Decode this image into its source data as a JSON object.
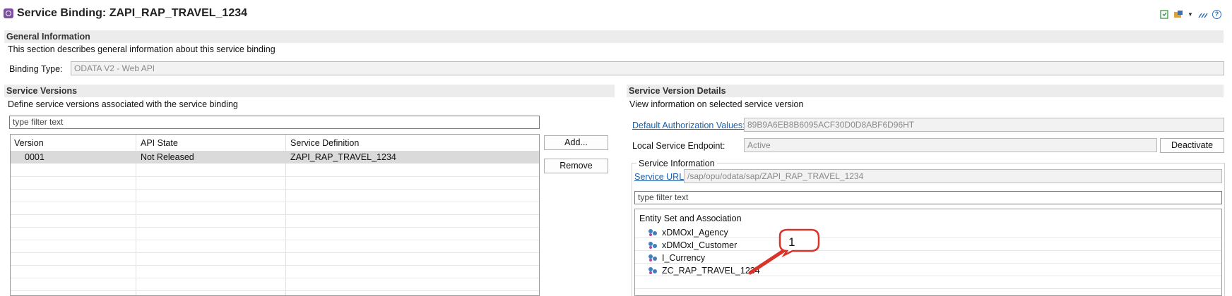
{
  "window": {
    "title": "Service Binding: ZAPI_RAP_TRAVEL_1234"
  },
  "general": {
    "heading": "General Information",
    "description": "This section describes general information about this service binding",
    "binding_type_label": "Binding Type:",
    "binding_type_value": "ODATA V2 - Web API"
  },
  "versions": {
    "heading": "Service Versions",
    "description": "Define service versions associated with the service binding",
    "filter_placeholder": "type filter text",
    "columns": [
      "Version",
      "API State",
      "Service Definition"
    ],
    "rows": [
      {
        "version": "0001",
        "api_state": "Not Released",
        "service_definition": "ZAPI_RAP_TRAVEL_1234"
      }
    ],
    "add_label": "Add...",
    "remove_label": "Remove"
  },
  "details": {
    "heading": "Service Version Details",
    "description": "View information on selected service version",
    "auth_link": "Default Authorization Values:",
    "auth_value": "89B9A6EB8B6095ACF30D0D8ABF6D96HT",
    "endpoint_label": "Local Service Endpoint:",
    "endpoint_value": "Active",
    "deactivate_label": "Deactivate",
    "service_info_legend": "Service Information",
    "service_url_link": "Service URL:",
    "service_url_value": "/sap/opu/odata/sap/ZAPI_RAP_TRAVEL_1234",
    "filter_placeholder": "type filter text",
    "entity_header": "Entity Set and Association",
    "entities": [
      "xDMOxI_Agency",
      "xDMOxI_Customer",
      "I_Currency",
      "ZC_RAP_TRAVEL_1234"
    ]
  },
  "callout": {
    "number": "1"
  },
  "colors": {
    "section_bg": "#ececec",
    "link": "#1c5fa8",
    "selected_row": "#dadada",
    "callout_red": "#d9342b"
  },
  "toolbar_icons": [
    "export-icon",
    "settings-icon",
    "dropdown-icon",
    "edit-icon",
    "help-icon"
  ]
}
